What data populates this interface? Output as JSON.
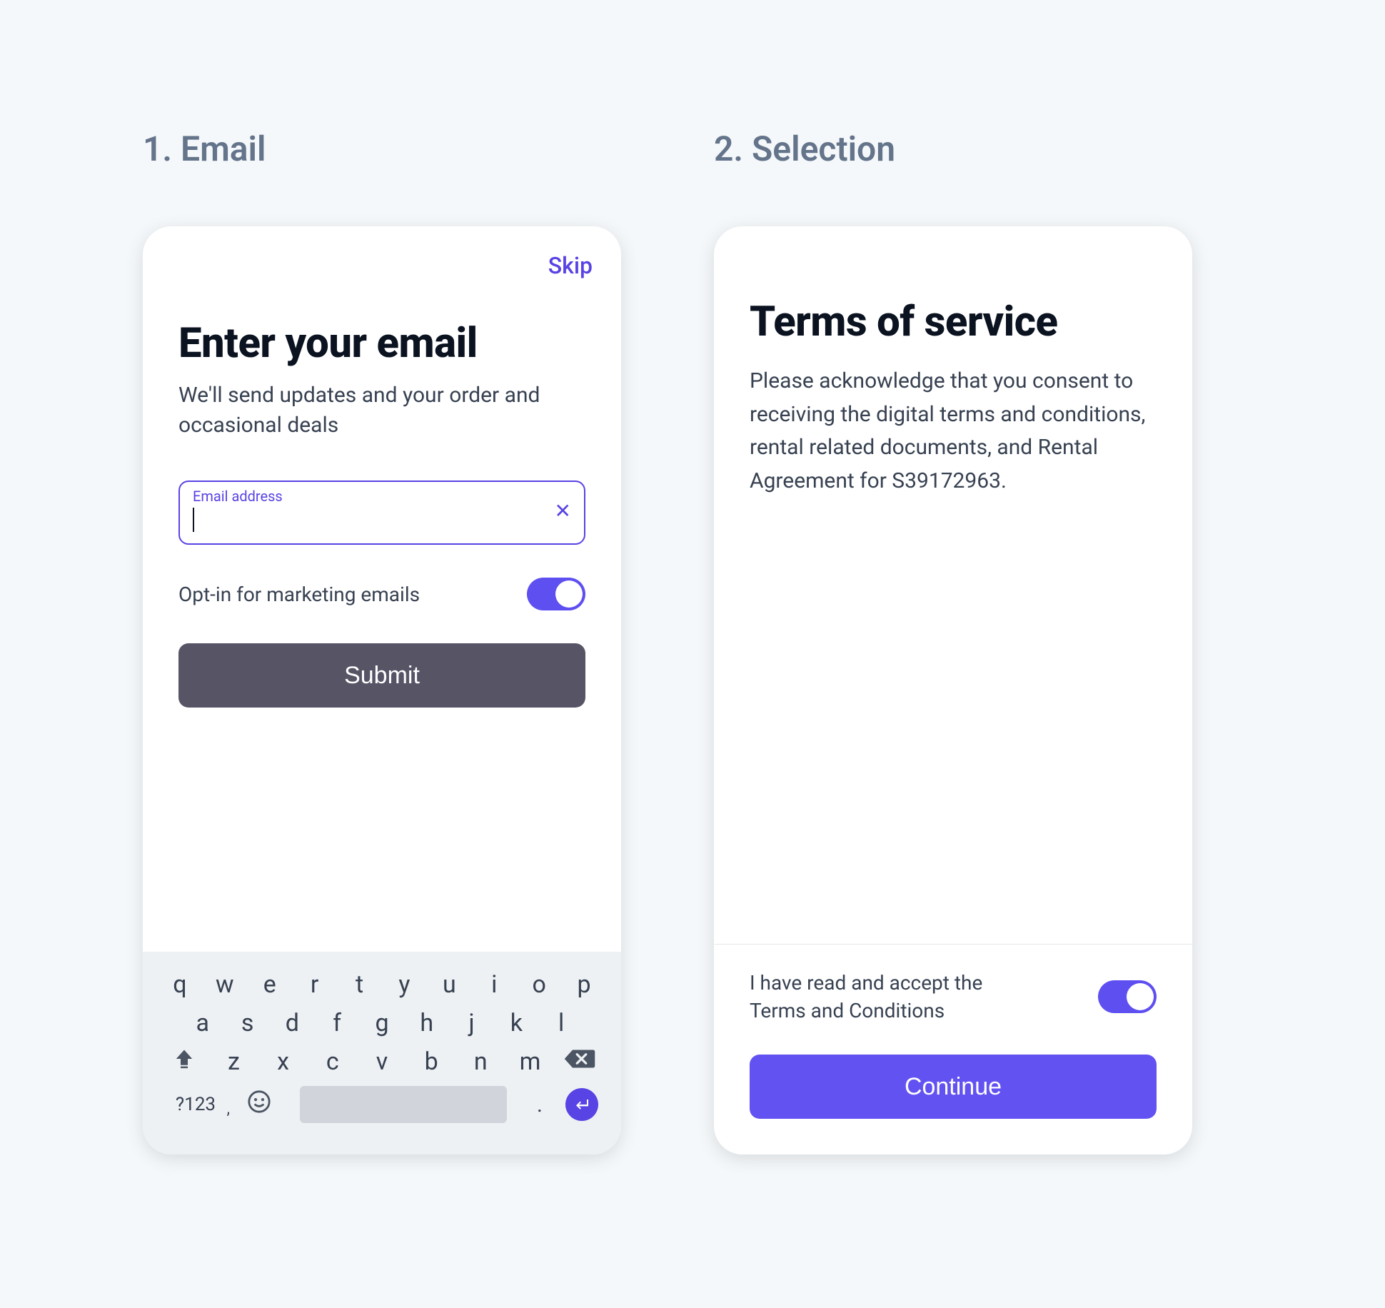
{
  "steps": {
    "one": "1. Email",
    "two": "2. Selection"
  },
  "email_screen": {
    "skip": "Skip",
    "title": "Enter your email",
    "subtitle": "We'll send updates and your order and occasional deals",
    "field_label": "Email address",
    "field_value": "",
    "clear_glyph": "✕",
    "optin_label": "Opt-in for marketing emails",
    "optin_on": true,
    "submit": "Submit"
  },
  "keyboard": {
    "row1": [
      "q",
      "w",
      "e",
      "r",
      "t",
      "y",
      "u",
      "i",
      "o",
      "p"
    ],
    "row2": [
      "a",
      "s",
      "d",
      "f",
      "g",
      "h",
      "j",
      "k",
      "l"
    ],
    "row3": [
      "z",
      "x",
      "c",
      "v",
      "b",
      "n",
      "m"
    ],
    "numeric": "?123",
    "comma": ",",
    "dot": "."
  },
  "terms_screen": {
    "title": "Terms of service",
    "body": "Please acknowledge that you consent to receiving the digital terms and conditions, rental related documents, and Rental Agreement for S39172963.",
    "accept_label": "I have read and accept the Terms and Conditions",
    "accept_on": true,
    "continue": "Continue"
  },
  "colors": {
    "accent": "#5843e4",
    "button_secondary": "#575466",
    "button_primary": "#6352f2"
  }
}
